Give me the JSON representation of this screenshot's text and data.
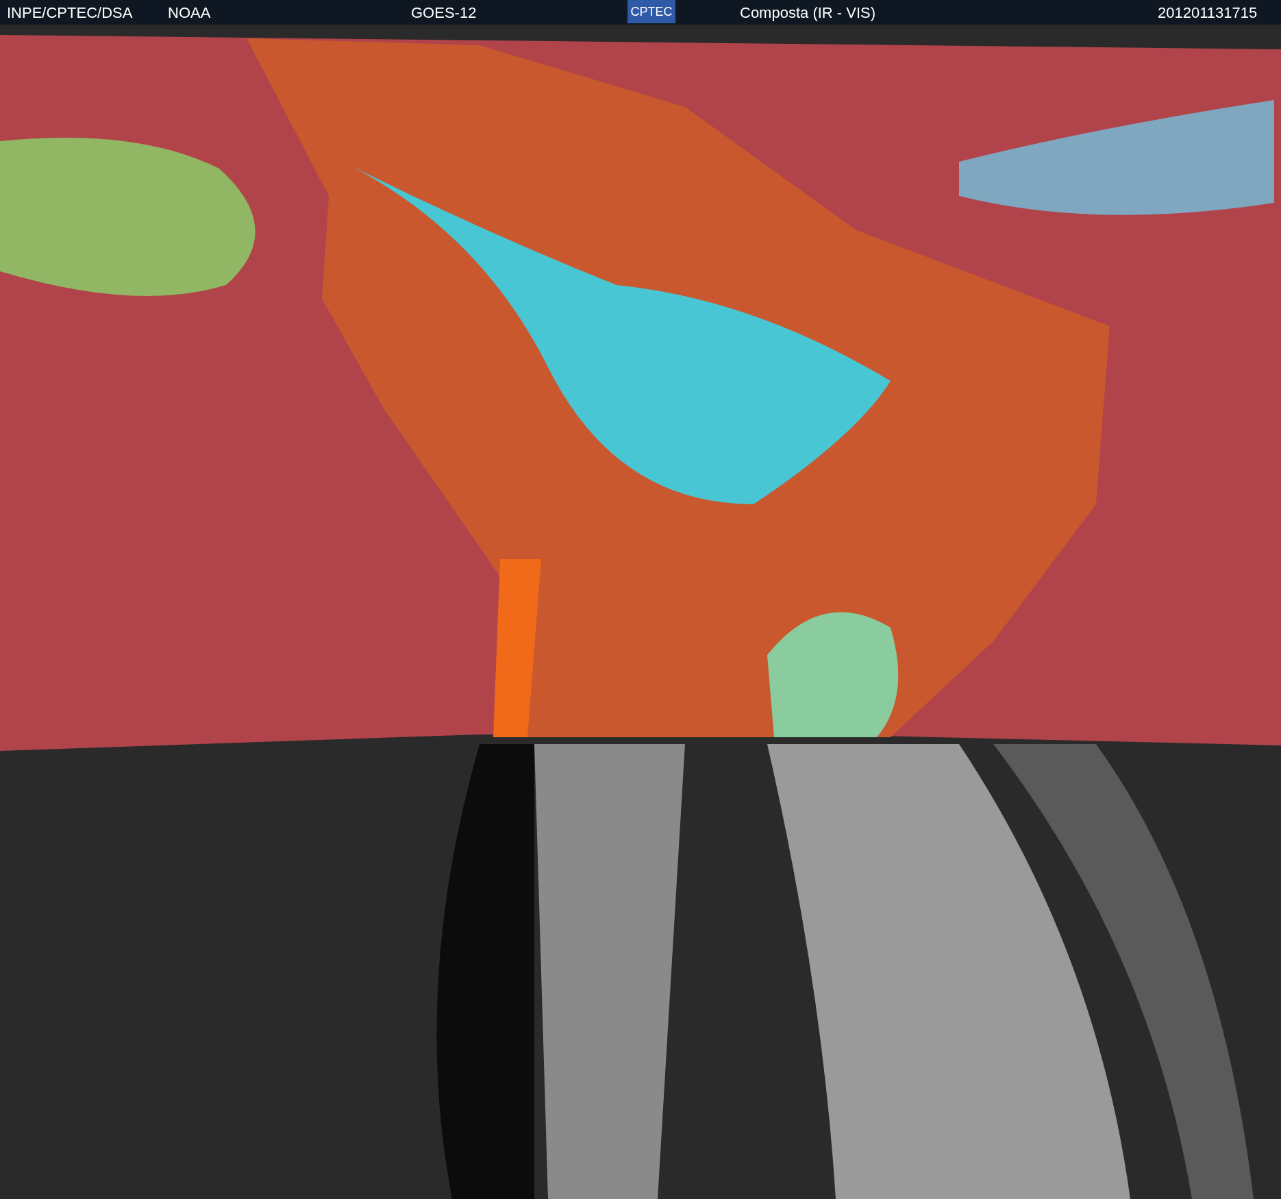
{
  "header": {
    "source": "INPE/CPTEC/DSA",
    "agency": "NOAA",
    "satellite": "GOES-12",
    "logo": "CPTEC",
    "product": "Composta (IR - VIS)",
    "timestamp": "201201131715"
  }
}
